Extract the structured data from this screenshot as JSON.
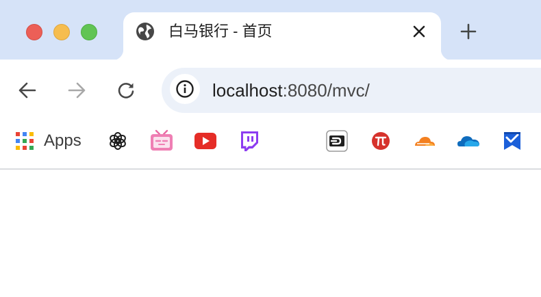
{
  "tab": {
    "title": "白马银行 - 首页",
    "favicon": "globe-icon"
  },
  "toolbar": {
    "back_icon": "arrow-left-icon",
    "forward_icon": "arrow-right-icon",
    "reload_icon": "reload-icon",
    "site_info_icon": "info-icon"
  },
  "address": {
    "host": "localhost",
    "path": ":8080/mvc/"
  },
  "bookmarks": {
    "apps_label": "Apps",
    "items": [
      "openai-icon",
      "bilibili-icon",
      "youtube-icon",
      "twitch-icon",
      "dark-app-icon",
      "pi-icon",
      "cloudflare-icon",
      "onedrive-icon",
      "bookmark-icon"
    ]
  },
  "colors": {
    "tabstrip": "#d6e3f8",
    "omnibox": "#ecf1f9",
    "traffic_close": "#ec5f57",
    "traffic_minimize": "#f6bd4f",
    "traffic_maximize": "#61c454"
  }
}
